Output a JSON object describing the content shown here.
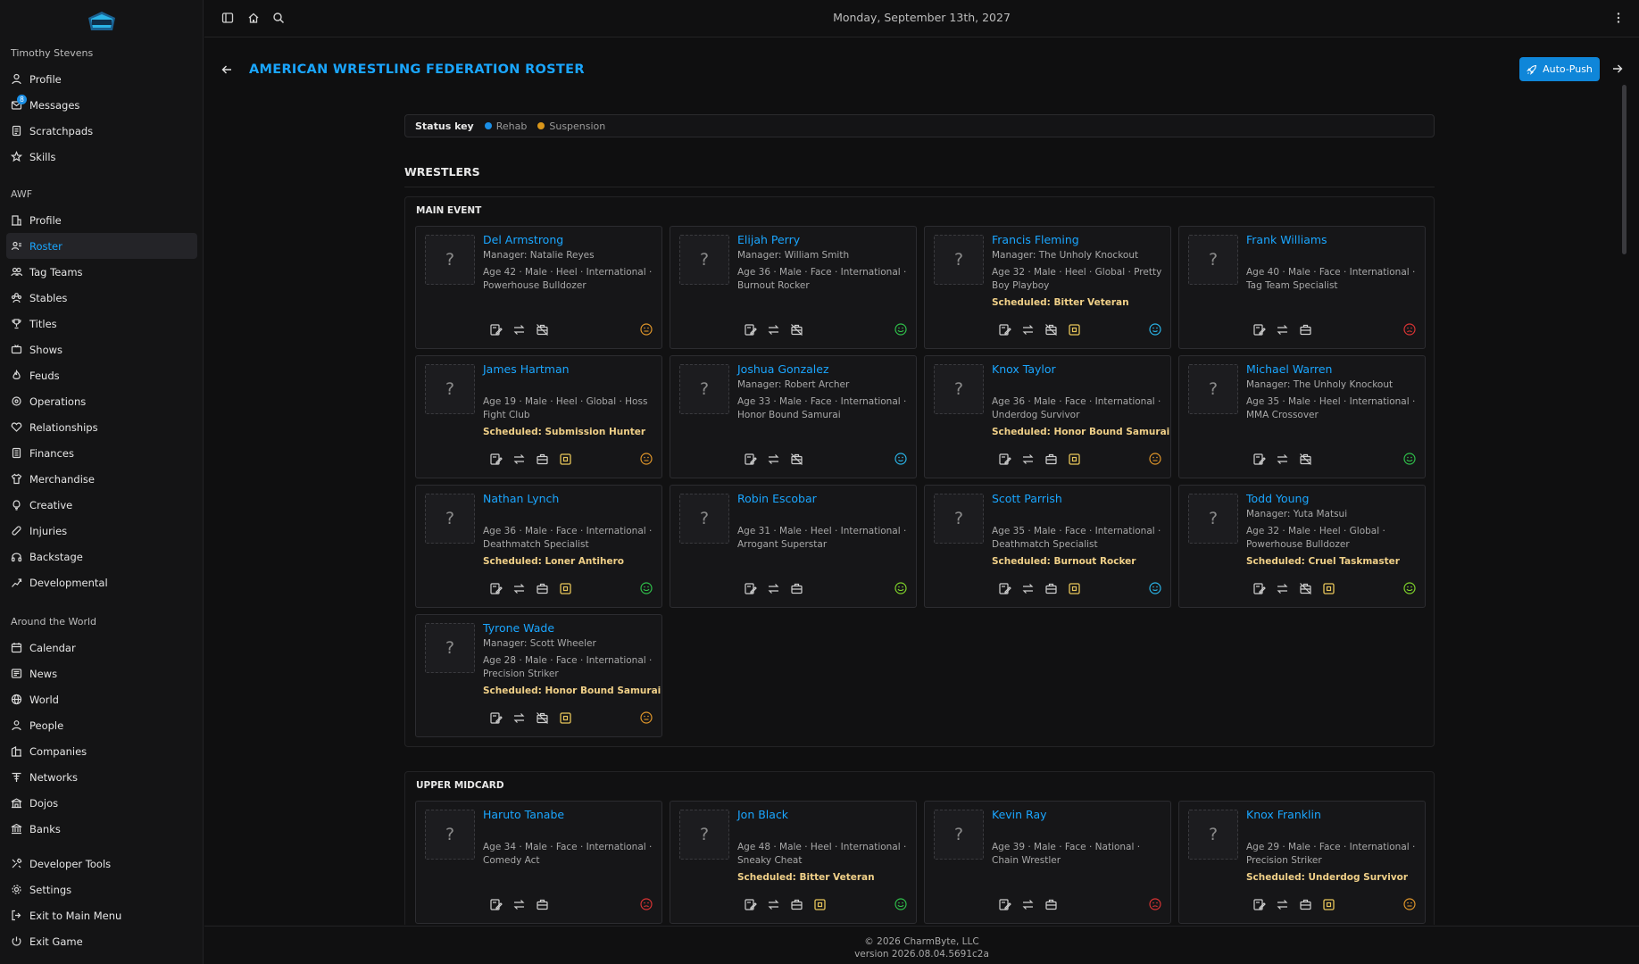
{
  "topbar": {
    "date": "Monday, September 13th, 2027"
  },
  "sidebar": {
    "user_heading": "Timothy Stevens",
    "user_items": [
      {
        "label": "Profile",
        "icon": "user-icon"
      },
      {
        "label": "Messages",
        "icon": "messages-icon",
        "badge": "8"
      },
      {
        "label": "Scratchpads",
        "icon": "notepad-icon"
      },
      {
        "label": "Skills",
        "icon": "star-icon"
      }
    ],
    "company_heading": "AWF",
    "company_items": [
      {
        "label": "Profile",
        "icon": "building-icon"
      },
      {
        "label": "Roster",
        "icon": "roster-icon",
        "active": true
      },
      {
        "label": "Tag Teams",
        "icon": "tag-team-icon"
      },
      {
        "label": "Stables",
        "icon": "stables-icon"
      },
      {
        "label": "Titles",
        "icon": "trophy-icon"
      },
      {
        "label": "Shows",
        "icon": "tv-icon"
      },
      {
        "label": "Feuds",
        "icon": "flame-icon"
      },
      {
        "label": "Operations",
        "icon": "operations-icon"
      },
      {
        "label": "Relationships",
        "icon": "heart-icon"
      },
      {
        "label": "Finances",
        "icon": "finances-icon"
      },
      {
        "label": "Merchandise",
        "icon": "shirt-icon"
      },
      {
        "label": "Creative",
        "icon": "lightbulb-icon"
      },
      {
        "label": "Injuries",
        "icon": "bandage-icon"
      },
      {
        "label": "Backstage",
        "icon": "headphones-icon"
      },
      {
        "label": "Developmental",
        "icon": "growth-icon"
      }
    ],
    "world_heading": "Around the World",
    "world_items": [
      {
        "label": "Calendar",
        "icon": "calendar-icon"
      },
      {
        "label": "News",
        "icon": "newspaper-icon"
      },
      {
        "label": "World",
        "icon": "globe-icon"
      },
      {
        "label": "People",
        "icon": "people-icon"
      },
      {
        "label": "Companies",
        "icon": "companies-icon"
      },
      {
        "label": "Networks",
        "icon": "antenna-icon"
      },
      {
        "label": "Dojos",
        "icon": "dojo-icon"
      },
      {
        "label": "Banks",
        "icon": "bank-icon"
      }
    ],
    "bottom_items": [
      {
        "label": "Developer Tools",
        "icon": "tools-icon"
      },
      {
        "label": "Settings",
        "icon": "gear-icon"
      },
      {
        "label": "Exit to Main Menu",
        "icon": "exit-icon"
      },
      {
        "label": "Exit Game",
        "icon": "power-icon"
      }
    ]
  },
  "page": {
    "title": "AMERICAN WRESTLING FEDERATION ROSTER",
    "autopush_label": "Auto-Push"
  },
  "status_key": {
    "label": "Status key",
    "items": [
      {
        "label": "Rehab",
        "color": "#1a8fe6"
      },
      {
        "label": "Suspension",
        "color": "#d9961a"
      }
    ]
  },
  "wrestlers_heading": "WRESTLERS",
  "colors": {
    "accent": "#1aa6ff",
    "scheduled": "#f0d088",
    "happy": "#2fbf4a",
    "content": "#2ab3e6",
    "neutral": "#e0962a",
    "upset": "#d93434"
  },
  "groups": [
    {
      "title": "MAIN EVENT",
      "wrestlers": [
        {
          "name": "Del Armstrong",
          "manager": "Manager: Natalie Reyes",
          "info": "Age 42 · Male · Heel · International · Powerhouse Bulldozer",
          "scheduled": "",
          "actions": [
            "edit",
            "swap",
            "hire-off"
          ],
          "mood": "neutral"
        },
        {
          "name": "Elijah Perry",
          "manager": "Manager: William Smith",
          "info": "Age 36 · Male · Face · International · Burnout Rocker",
          "scheduled": "",
          "actions": [
            "edit",
            "swap",
            "hire-off"
          ],
          "mood": "happy"
        },
        {
          "name": "Francis Fleming",
          "manager": "Manager: The Unholy Knockout",
          "info": "Age 32 · Male · Heel · Global · Pretty Boy Playboy",
          "scheduled": "Scheduled: Bitter Veteran",
          "actions": [
            "edit",
            "swap",
            "hire-off",
            "schedule"
          ],
          "mood": "content"
        },
        {
          "name": "Frank Williams",
          "manager": "",
          "info": "Age 40 · Male · Face · International · Tag Team Specialist",
          "scheduled": "",
          "actions": [
            "edit",
            "swap",
            "hire"
          ],
          "mood": "upset"
        },
        {
          "name": "James Hartman",
          "manager": "",
          "info": "Age 19 · Male · Heel · Global · Hoss Fight Club",
          "scheduled": "Scheduled: Submission Hunter",
          "actions": [
            "edit",
            "swap",
            "hire",
            "schedule"
          ],
          "mood": "neutral"
        },
        {
          "name": "Joshua Gonzalez",
          "manager": "Manager: Robert Archer",
          "info": "Age 33 · Male · Face · International · Honor Bound Samurai",
          "scheduled": "",
          "actions": [
            "edit",
            "swap",
            "hire-off"
          ],
          "mood": "content"
        },
        {
          "name": "Knox Taylor",
          "manager": "",
          "info": "Age 36 · Male · Face · International · Underdog Survivor",
          "scheduled": "Scheduled: Honor Bound Samurai",
          "actions": [
            "edit",
            "swap",
            "hire",
            "schedule"
          ],
          "mood": "neutral"
        },
        {
          "name": "Michael Warren",
          "manager": "Manager: The Unholy Knockout",
          "info": "Age 35 · Male · Heel · International · MMA Crossover",
          "scheduled": "",
          "actions": [
            "edit",
            "swap",
            "hire-off"
          ],
          "mood": "happy"
        },
        {
          "name": "Nathan Lynch",
          "manager": "",
          "info": "Age 36 · Male · Face · International · Deathmatch Specialist",
          "scheduled": "Scheduled: Loner Antihero",
          "actions": [
            "edit",
            "swap",
            "hire",
            "schedule"
          ],
          "mood": "happy"
        },
        {
          "name": "Robin Escobar",
          "manager": "",
          "info": "Age 31 · Male · Heel · International · Arrogant Superstar",
          "scheduled": "",
          "actions": [
            "edit",
            "swap",
            "hire"
          ],
          "mood": "happy-lime"
        },
        {
          "name": "Scott Parrish",
          "manager": "",
          "info": "Age 35 · Male · Face · International · Deathmatch Specialist",
          "scheduled": "Scheduled: Burnout Rocker",
          "actions": [
            "edit",
            "swap",
            "hire",
            "schedule"
          ],
          "mood": "content"
        },
        {
          "name": "Todd Young",
          "manager": "Manager: Yuta Matsui",
          "info": "Age 32 · Male · Heel · Global · Powerhouse Bulldozer",
          "scheduled": "Scheduled: Cruel Taskmaster",
          "actions": [
            "edit",
            "swap",
            "hire-off",
            "schedule"
          ],
          "mood": "happy-lime"
        },
        {
          "name": "Tyrone Wade",
          "manager": "Manager: Scott Wheeler",
          "info": "Age 28 · Male · Face · International · Precision Striker",
          "scheduled": "Scheduled: Honor Bound Samurai",
          "actions": [
            "edit",
            "swap",
            "hire-off",
            "schedule"
          ],
          "mood": "neutral"
        }
      ]
    },
    {
      "title": "UPPER MIDCARD",
      "wrestlers": [
        {
          "name": "Haruto Tanabe",
          "manager": "",
          "info": "Age 34 · Male · Face · International · Comedy Act",
          "scheduled": "",
          "actions": [
            "edit",
            "swap",
            "hire"
          ],
          "mood": "upset"
        },
        {
          "name": "Jon Black",
          "manager": "",
          "info": "Age 48 · Male · Heel · International · Sneaky Cheat",
          "scheduled": "Scheduled: Bitter Veteran",
          "actions": [
            "edit",
            "swap",
            "hire",
            "schedule"
          ],
          "mood": "happy"
        },
        {
          "name": "Kevin Ray",
          "manager": "",
          "info": "Age 39 · Male · Face · National · Chain Wrestler",
          "scheduled": "",
          "actions": [
            "edit",
            "swap",
            "hire"
          ],
          "mood": "upset"
        },
        {
          "name": "Knox Franklin",
          "manager": "",
          "info": "Age 29 · Male · Face · International · Precision Striker",
          "scheduled": "Scheduled: Underdog Survivor",
          "actions": [
            "edit",
            "swap",
            "hire",
            "schedule"
          ],
          "mood": "neutral"
        }
      ]
    }
  ],
  "footer": {
    "copyright": "© 2026 CharmByte, LLC",
    "version": "version 2026.08.04.5691c2a"
  }
}
